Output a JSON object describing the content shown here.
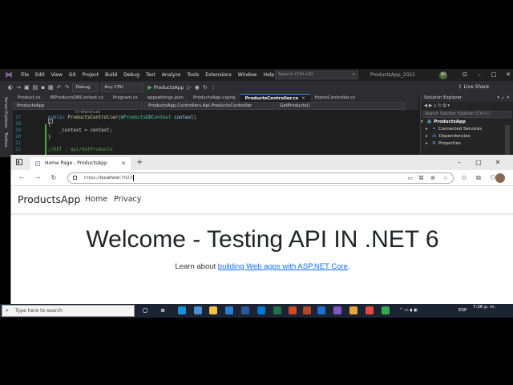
{
  "vs": {
    "menu": [
      "File",
      "Edit",
      "View",
      "Git",
      "Project",
      "Build",
      "Debug",
      "Test",
      "Analyze",
      "Tools",
      "Extensions",
      "Window",
      "Help"
    ],
    "search_placeholder": "Search (Ctrl+Q)",
    "window_title": "ProductsApp_2022",
    "user_initials": "DR",
    "toolbar": {
      "config": "Debug",
      "platform": "Any CPU",
      "run_target": "ProductsApp",
      "live_share": "Live Share"
    },
    "side_tabs": [
      "Server Explorer",
      "Toolbox"
    ],
    "tabs": [
      "Product.cs",
      "WProductsDBContext.cs",
      "Program.cs",
      "appsettings.json",
      "ProductsApp.csproj",
      "ProductsController.cs",
      "HomeController.cs"
    ],
    "active_tab_index": 5,
    "nav": {
      "project": "ProductsApp",
      "class": "ProductsApp.Controllers.Api.ProductsController",
      "member": "GetProducts()"
    },
    "code": {
      "references": "0 references",
      "lines": [
        {
          "num": "17",
          "kw": "public",
          "name": "ProductsController",
          "open": "(",
          "type": "WProductsDBContext",
          "param": "context",
          "close": ")"
        },
        {
          "num": "18",
          "text": "{"
        },
        {
          "num": "19",
          "text": "    _context = context;"
        },
        {
          "num": "20",
          "text": "}"
        },
        {
          "num": "21",
          "text": ""
        },
        {
          "num": "22",
          "comment": "//GET : api/GetProducts"
        }
      ]
    },
    "solution": {
      "title": "Solution Explorer",
      "search_placeholder": "Search Solution Explorer (Ctrl+;)",
      "items": [
        {
          "label": "ProductsApp",
          "bold": true
        },
        {
          "label": "Connected Services"
        },
        {
          "label": "Dependencies"
        },
        {
          "label": "Properties"
        }
      ]
    }
  },
  "browser": {
    "tab_title": "Home Page - ProductsApp",
    "new_tab": "+",
    "url_prefix": "https://",
    "url_host": "localhost",
    "url_port": ":7023",
    "site": {
      "brand": "ProductsApp",
      "links": [
        "Home",
        "Privacy"
      ],
      "hero_title": "Welcome - Testing API IN .NET 6",
      "hero_text": "Learn about ",
      "hero_link": "building Web apps with ASP.NET Core",
      "hero_end": "."
    }
  },
  "taskbar": {
    "search_placeholder": "Type here to search",
    "language": "ESP",
    "time": "7:26 p. m."
  },
  "colors": {
    "vs_bg": "#1f1f1f",
    "link": "#0d6efd",
    "taskbar": "#1c2433"
  }
}
